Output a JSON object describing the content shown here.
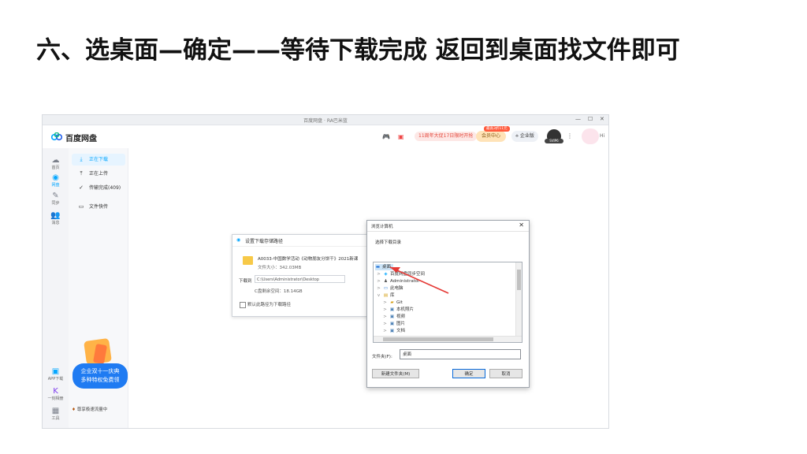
{
  "slide": {
    "title": "六、选桌面—确定——等待下载完成  返回到桌面找文件即可"
  },
  "window": {
    "title": "百度网盘 · RA巴米蓝",
    "minimize": "—",
    "maximize": "☐",
    "close": "✕"
  },
  "app": {
    "name": "百度网盘",
    "promo_text": "11周年大促17日限时开抢",
    "vip_tag": "最高3折11元",
    "vip_label": "会员中心",
    "enterprise_label": "企业版",
    "avatar_badge": "SVIP6",
    "greeting": "Hi"
  },
  "rail": {
    "items": [
      {
        "label": "首页",
        "icon": "cloud-icon"
      },
      {
        "label": "网盘",
        "icon": "disk-icon"
      },
      {
        "label": "同步",
        "icon": "sync-icon"
      },
      {
        "label": "消息",
        "icon": "people-icon"
      }
    ],
    "bottom": [
      {
        "label": "APP下载",
        "icon": "phone-icon"
      },
      {
        "label": "一刻相册",
        "icon": "album-icon"
      },
      {
        "label": "工具",
        "icon": "tools-icon"
      }
    ]
  },
  "sidebar": {
    "items": [
      {
        "label": "正在下载",
        "icon": "⤓"
      },
      {
        "label": "正在上传",
        "icon": "⤒"
      },
      {
        "label": "传输完成(409)",
        "icon": "✓"
      },
      {
        "label": "文件快传",
        "icon": "▭"
      }
    ],
    "promo_line1": "企业双十一庆典",
    "promo_line2": "多种特权免费领",
    "vip_accel": "尊享极速流量中"
  },
  "save_dialog": {
    "title": "设置下载存储路径",
    "file_name": "A0033-中国数学活动《动物朋友分饼干》2021新课",
    "file_size": "文件大小：342.03MB",
    "path_label": "下载到",
    "path_value": "C:\\Users\\Administrator\\Desktop",
    "free_space": "C盘剩余空间：18.14GB",
    "default_checkbox_label": "默认此路径为下载路径"
  },
  "browse_dialog": {
    "title": "浏览计算机",
    "subtitle": "选择下载目录",
    "tree": [
      {
        "label": "桌面",
        "indent": 0,
        "expander": "",
        "icon": "desktop-icon",
        "selected": true
      },
      {
        "label": "百度网盘同步空间",
        "indent": 1,
        "expander": ">",
        "icon": "sync-folder-icon"
      },
      {
        "label": "Administrator",
        "indent": 1,
        "expander": ">",
        "icon": "user-icon"
      },
      {
        "label": "此电脑",
        "indent": 1,
        "expander": ">",
        "icon": "computer-icon"
      },
      {
        "label": "库",
        "indent": 1,
        "expander": "v",
        "icon": "library-icon"
      },
      {
        "label": "Git",
        "indent": 2,
        "expander": ">",
        "icon": "folder-icon"
      },
      {
        "label": "本机照片",
        "indent": 2,
        "expander": ">",
        "icon": "photo-icon"
      },
      {
        "label": "视频",
        "indent": 2,
        "expander": ">",
        "icon": "video-icon"
      },
      {
        "label": "图片",
        "indent": 2,
        "expander": ">",
        "icon": "picture-icon"
      },
      {
        "label": "文档",
        "indent": 2,
        "expander": ">",
        "icon": "document-icon"
      }
    ],
    "folder_label": "文件夹(F):",
    "folder_value": "桌面",
    "new_folder_button": "新建文件夹(M)",
    "ok_button": "确定",
    "cancel_button": "取消"
  },
  "colors": {
    "accent": "#06a7ff",
    "arrow": "#e53935",
    "promo_blue": "#1f7bf2"
  }
}
